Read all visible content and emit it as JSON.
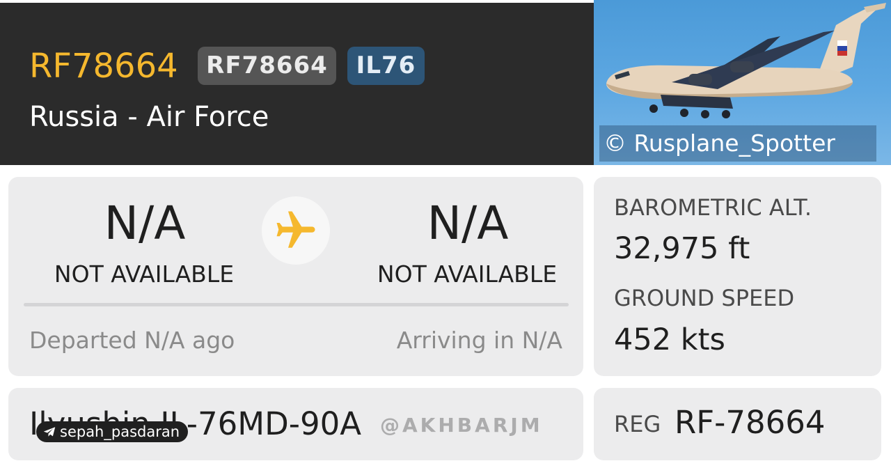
{
  "flight": {
    "callsign": "RF78664",
    "callsign_badge": "RF78664",
    "type_badge": "IL76",
    "operator": "Russia - Air Force"
  },
  "photo": {
    "credit": "© Rusplane_Spotter"
  },
  "route": {
    "origin": {
      "code": "N/A",
      "name": "NOT AVAILABLE"
    },
    "destination": {
      "code": "N/A",
      "name": "NOT AVAILABLE"
    },
    "departed": "Departed N/A ago",
    "arriving": "Arriving in N/A"
  },
  "stats": {
    "altitude_label": "BAROMETRIC ALT.",
    "altitude_value": "32,975 ft",
    "speed_label": "GROUND SPEED",
    "speed_value": "452 kts"
  },
  "aircraft": {
    "model": "Ilyushin IL-76MD-90A",
    "reg_label": "REG",
    "reg_value": "RF-78664"
  },
  "overlays": {
    "watermark": "@AKHBARJM",
    "channel": "sepah_pasdaran"
  },
  "colors": {
    "callsign": "#f5b82e",
    "header_bg": "#2b2b2b",
    "type_badge_bg": "#2d5577",
    "plane_icon": "#f5b82e"
  },
  "icons": {
    "route_plane": "airplane-icon",
    "channel": "telegram-icon"
  }
}
